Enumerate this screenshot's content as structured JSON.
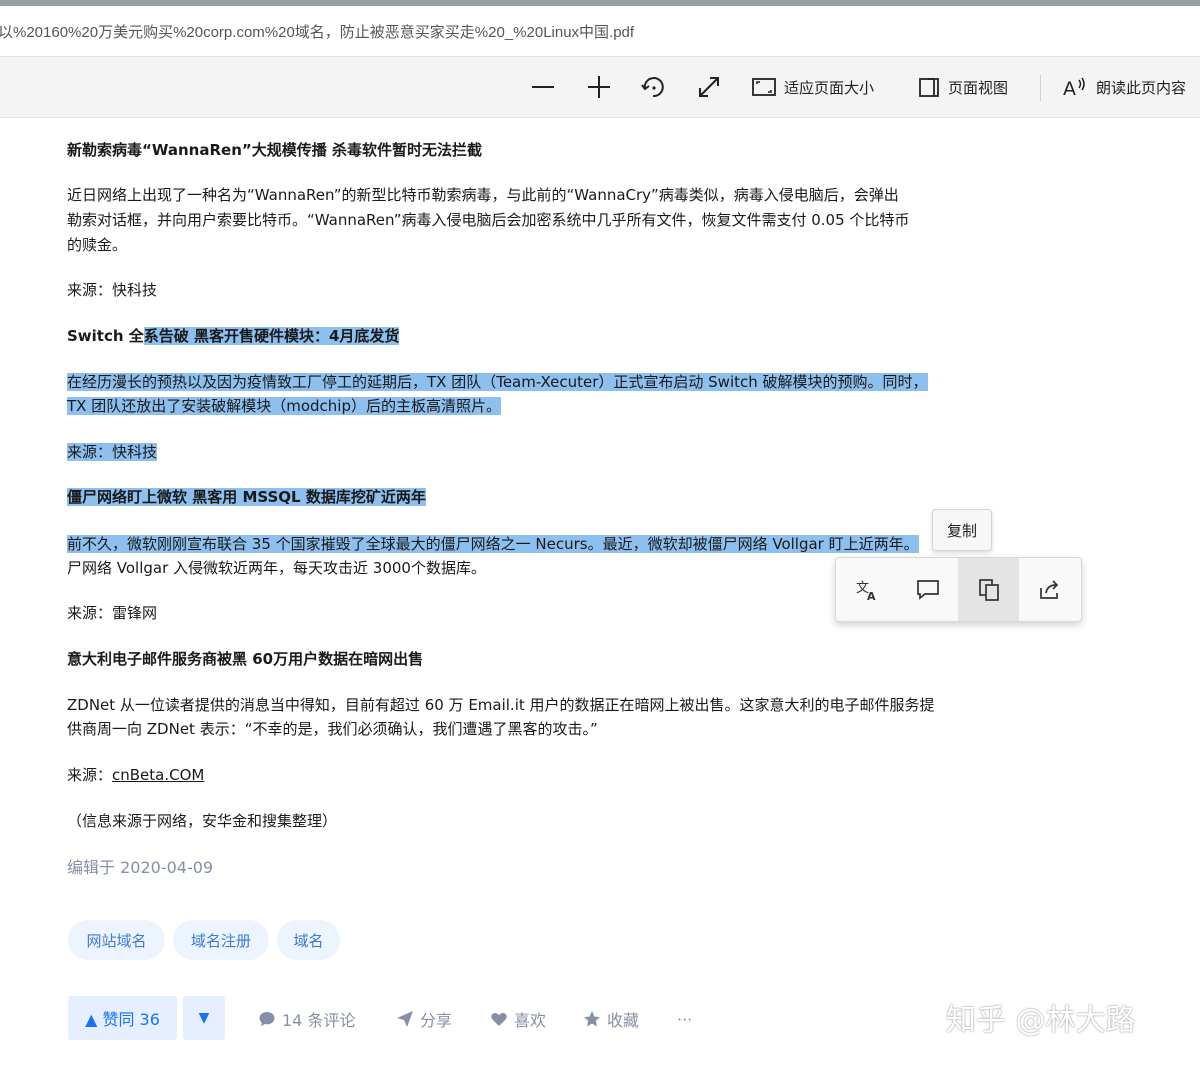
{
  "url": "以%20160%20万美元购买%20corp.com%20域名，防止被恶意买家买走%20_%20Linux中国.pdf",
  "toolbar": {
    "fit_page": "适应页面大小",
    "page_view": "页面视图",
    "read_aloud": "朗读此页内容"
  },
  "article": {
    "items": [
      {
        "kind": "heading",
        "text": "新勒索病毒“WannaRen”大规模传播 杀毒软件暂时无法拦截"
      },
      {
        "kind": "para",
        "lines": [
          "近日网络上出现了一种名为“WannaRen”的新型比特币勒索病毒，与此前的“WannaCry”病毒类似，病毒入侵电脑后，会弹出",
          "勒索对话框，并向用户索要比特币。“WannaRen”病毒入侵电脑后会加密系统中几乎所有文件，恢复文件需支付 0.05 个比特币",
          "的赎金。"
        ]
      },
      {
        "kind": "source",
        "label": "来源：",
        "value": "快科技"
      },
      {
        "kind": "heading",
        "pre": "Switch 全",
        "text": "系告破 黑客开售硬件模块：4月底发货"
      },
      {
        "kind": "para",
        "lines": [
          "在经历漫长的预热以及因为疫情致工厂停工的延期后，TX 团队（Team-Xecuter）正式宣布启动 Switch 破解模块的预购。同时，",
          "TX 团队还放出了安装破解模块（modchip）后的主板高清照片。"
        ]
      },
      {
        "kind": "source",
        "label": "来源：",
        "value": "快科技"
      },
      {
        "kind": "heading",
        "text": "僵尸网络盯上微软 黑客用 MSSQL 数据库挖矿近两年"
      },
      {
        "kind": "para",
        "lines": [
          "前不久，微软刚刚宣布联合 35 个国家摧毁了全球最大的僵尸网络之一 Necurs。最近，微软却被僵尸网络 Vollgar 盯上近两年。",
          "尸网络 Vollgar 入侵微软近两年，每天攻击近 3000个数据库。"
        ]
      },
      {
        "kind": "source",
        "label": "来源：",
        "value": "雷锋网"
      },
      {
        "kind": "heading",
        "text": "意大利电子邮件服务商被黑 60万用户数据在暗网出售"
      },
      {
        "kind": "para",
        "lines": [
          "ZDNet 从一位读者提供的消息当中得知，目前有超过 60 万 Email.it 用户的数据正在暗网上被出售。这家意大利的电子邮件服务提",
          "供商周一向 ZDNet 表示：“不幸的是，我们必须确认，我们遭遇了黑客的攻击。”"
        ]
      },
      {
        "kind": "source",
        "label": "来源：",
        "value": "cnBeta.COM"
      },
      {
        "kind": "note",
        "text": "（信息来源于网络，安华金和搜集整理）"
      }
    ],
    "edited": "编辑于 2020-04-09"
  },
  "tags": [
    "网站域名",
    "域名注册",
    "域名"
  ],
  "actions": {
    "upvote": "▲ 赞同 36",
    "downvote": "▼",
    "comments": "14 条评论",
    "share": "分享",
    "like": "喜欢",
    "favorite": "收藏",
    "more": "···"
  },
  "popup": {
    "copy": "复制"
  },
  "watermark": "知乎 @林大路"
}
